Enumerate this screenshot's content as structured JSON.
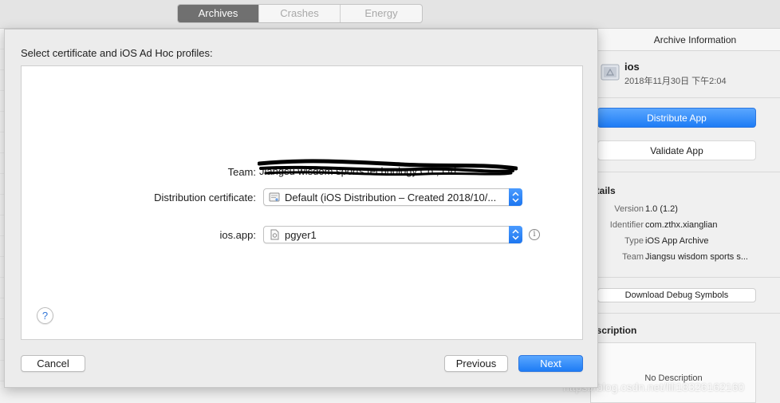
{
  "tabs": [
    {
      "label": "Archives",
      "active": true
    },
    {
      "label": "Crashes",
      "active": false
    },
    {
      "label": "Energy",
      "active": false
    }
  ],
  "right_panel": {
    "header": "Archive Information",
    "archive_name": "ios",
    "archive_date": "2018年11月30日 下午2:04",
    "distribute_label": "Distribute App",
    "validate_label": "Validate App",
    "details_heading": "etails",
    "details": [
      {
        "label": "Version",
        "value": "1.0 (1.2)"
      },
      {
        "label": "Identifier",
        "value": "com.zthx.xianglian"
      },
      {
        "label": "Type",
        "value": "iOS App Archive"
      },
      {
        "label": "Team",
        "value": "Jiangsu wisdom sports s..."
      }
    ],
    "debug_symbols_label": "Download Debug Symbols",
    "description_heading": "escription",
    "description_text": "No Description"
  },
  "sheet": {
    "title": "Select certificate and iOS Ad Hoc profiles:",
    "team_label": "Team:",
    "team_value": "Jiangsu wisdom sports technology Co., Ltd.",
    "cert_label": "Distribution certificate:",
    "cert_value": "Default (iOS Distribution – Created 2018/10/...",
    "profile_label": "ios.app:",
    "profile_value": "pgyer1",
    "help_symbol": "?",
    "info_symbol": "i",
    "cancel_label": "Cancel",
    "previous_label": "Previous",
    "next_label": "Next"
  },
  "watermark": "https://blog.csdn.net/lili18326162160",
  "colors": {
    "accent": "#1e7cf5",
    "active_tab": "#707070"
  }
}
